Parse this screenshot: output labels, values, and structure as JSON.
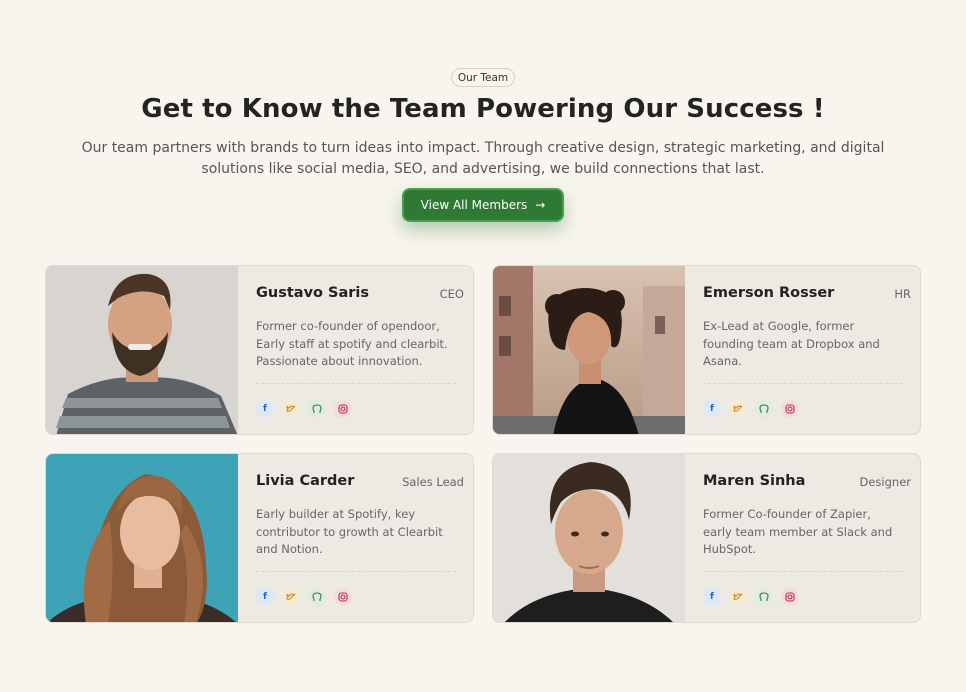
{
  "header": {
    "badge": "Our Team",
    "title": "Get to Know the Team Powering Our Success !",
    "subtitle": "Our team partners with brands to turn ideas into impact. Through creative design, strategic marketing, and digital solutions like social media, SEO, and advertising, we build connections that last.",
    "cta_label": "View All Members",
    "cta_arrow": "→"
  },
  "members": [
    {
      "name": "Gustavo Saris",
      "role": "CEO",
      "bio": "Former co-founder of opendoor, Early staff at spotify and clearbit. Passionate about innovation."
    },
    {
      "name": "Emerson Rosser",
      "role": "HR",
      "bio": "Ex-Lead at Google, former founding team at Dropbox and Asana."
    },
    {
      "name": "Livia Carder",
      "role": "Sales Lead",
      "bio": "Early builder at Spotify, key contributor to growth at Clearbit and Notion."
    },
    {
      "name": "Maren Sinha",
      "role": "Designer",
      "bio": "Former Co-founder of Zapier, early team member at Slack and HubSpot."
    }
  ],
  "social_icons": [
    "facebook-icon",
    "twitter-icon",
    "github-icon",
    "instagram-icon"
  ],
  "colors": {
    "background": "#f8f5ef",
    "card": "#ede9e3",
    "accent_green": "#2e7a35",
    "facebook": "#2b62c9",
    "twitter": "#c98a17",
    "github": "#2e7a35",
    "instagram": "#c2293b"
  }
}
